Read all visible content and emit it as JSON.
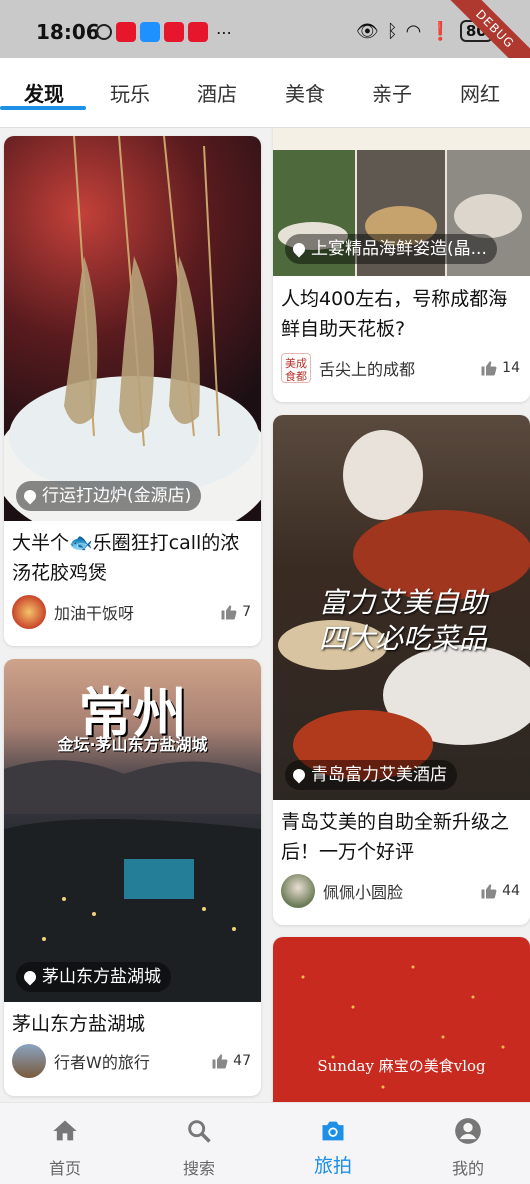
{
  "status_bar": {
    "time": "18:06",
    "battery": "80",
    "debug": "DEBUG"
  },
  "tabs": [
    {
      "label": "发现",
      "active": true
    },
    {
      "label": "玩乐"
    },
    {
      "label": "酒店"
    },
    {
      "label": "美食"
    },
    {
      "label": "亲子"
    },
    {
      "label": "网红"
    }
  ],
  "feed": {
    "left": [
      {
        "location": "行运打边炉(金源店)",
        "title": "大半个🐟乐圈狂打call的浓汤花胶鸡煲",
        "author": "加油干饭呀",
        "likes": "7"
      },
      {
        "overlay_title": "常州",
        "overlay_subtitle": "金坛·茅山东方盐湖城",
        "location": "茅山东方盐湖城",
        "title": "茅山东方盐湖城",
        "author": "行者W的旅行",
        "likes": "47"
      }
    ],
    "right": [
      {
        "location": "上宴精品海鲜姿造(晶...",
        "title": "人均400左右，号称成都海鲜自助天花板?",
        "author": "舌尖上的成都",
        "avatar_text": "美成食都",
        "likes": "14"
      },
      {
        "overlay_title": "富力艾美自助",
        "overlay_subtitle": "四大必吃菜品",
        "location": "青岛富力艾美酒店",
        "title": "青岛艾美的自助全新升级之后！一万个好评",
        "author": "佩佩小圆脸",
        "likes": "44"
      },
      {
        "overlay_text": "Sunday 麻宝の美食vlog"
      }
    ]
  },
  "bottom_nav": [
    {
      "label": "首页",
      "icon": "home-icon"
    },
    {
      "label": "搜索",
      "icon": "search-icon"
    },
    {
      "label": "旅拍",
      "icon": "camera-icon",
      "active": true
    },
    {
      "label": "我的",
      "icon": "profile-icon"
    }
  ],
  "colors": {
    "accent": "#1d8fe6"
  }
}
